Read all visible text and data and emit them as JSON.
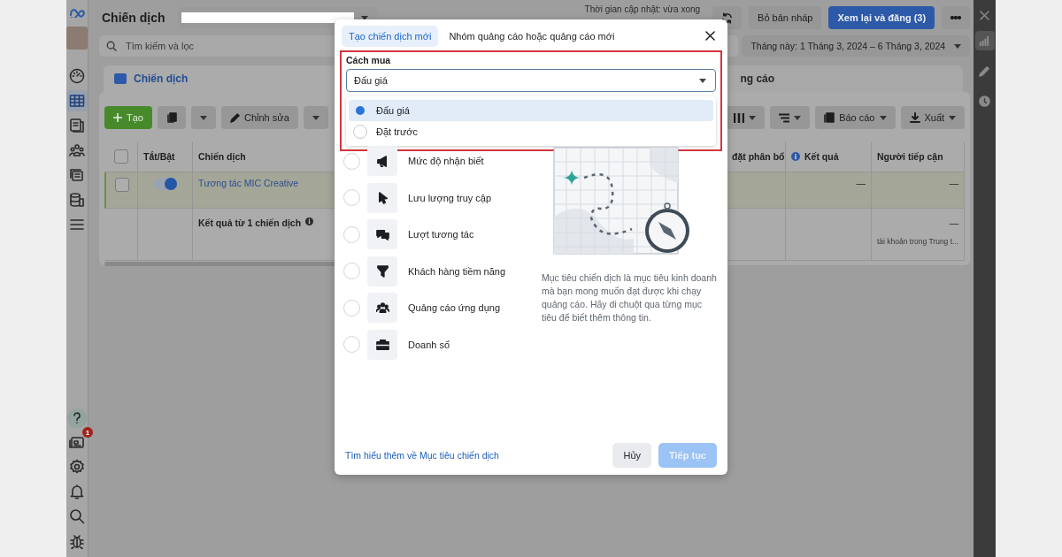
{
  "nav_rail": {
    "items": [
      {
        "selected": false
      },
      {
        "selected": true
      },
      {
        "selected": false
      },
      {
        "selected": false
      },
      {
        "selected": false
      },
      {
        "selected": false
      },
      {
        "selected": false
      }
    ],
    "notifications_badge": "1"
  },
  "header": {
    "title": "Chiến dịch",
    "update_status": "Thời gian cập nhật: vừa xong",
    "discard_button": "Bỏ bản nháp",
    "publish_button": "Xem lại và đăng (3)"
  },
  "search": {
    "placeholder": "Tìm kiếm và lọc"
  },
  "date_range": "Tháng này: 1 Tháng 3, 2024 – 6 Tháng 3, 2024",
  "level_tabs": [
    {
      "label": "Chiến dịch",
      "selected": true
    },
    {
      "label": "ng cáo",
      "selected": false
    }
  ],
  "toolbar": {
    "create_button": "Tạo",
    "edit_button": "Chỉnh sửa",
    "report_button": "Báo cáo",
    "export_button": "Xuất"
  },
  "table": {
    "select_all_checked": false,
    "columns": [
      {
        "label": "Tắt/Bật"
      },
      {
        "label": "Chiến dịch"
      },
      {
        "label": "đặt phân bổ"
      },
      {
        "label": "Kết quả"
      },
      {
        "label": "Người tiếp cận"
      }
    ],
    "rows": [
      {
        "kind": "campaign",
        "checked": false,
        "on": true,
        "name": "Tương tác MIC Creative",
        "result": "—",
        "reach": "—"
      },
      {
        "kind": "summary",
        "name": "Kết quả từ 1 chiến dịch",
        "reach": "—",
        "reach_note": "tài khoản trong Trung t..."
      }
    ]
  },
  "dialog": {
    "tabs": [
      {
        "label": "Tạo chiến dịch mới",
        "selected": true
      },
      {
        "label": "Nhóm quảng cáo hoặc quảng cáo mới",
        "selected": false
      }
    ],
    "buying_type": {
      "label": "Cách mua",
      "value": "Đấu giá",
      "expanded": true,
      "options": [
        {
          "label": "Đấu giá",
          "selected": true
        },
        {
          "label": "Đặt trước",
          "selected": false
        }
      ]
    },
    "objectives": [
      {
        "label": "Mức độ nhận biết",
        "selected": false
      },
      {
        "label": "Lưu lượng truy cập",
        "selected": false
      },
      {
        "label": "Lượt tương tác",
        "selected": false
      },
      {
        "label": "Khách hàng tiềm năng",
        "selected": false
      },
      {
        "label": "Quảng cáo ứng dụng",
        "selected": false
      },
      {
        "label": "Doanh số",
        "selected": false
      }
    ],
    "description": "Mục tiêu chiến dịch là mục tiêu kinh doanh mà bạn mong muốn đạt được khi chạy quảng cáo. Hãy di chuột qua từng mục tiêu để biết thêm thông tin.",
    "learn_more_link": "Tìm hiểu thêm về Mục tiêu chiến dịch",
    "cancel_button": "Hủy",
    "continue_button": {
      "label": "Tiếp tục",
      "disabled": true
    }
  },
  "side_panel": {
    "items": [
      {
        "selected": true
      },
      {
        "selected": false
      },
      {
        "selected": false
      }
    ]
  }
}
